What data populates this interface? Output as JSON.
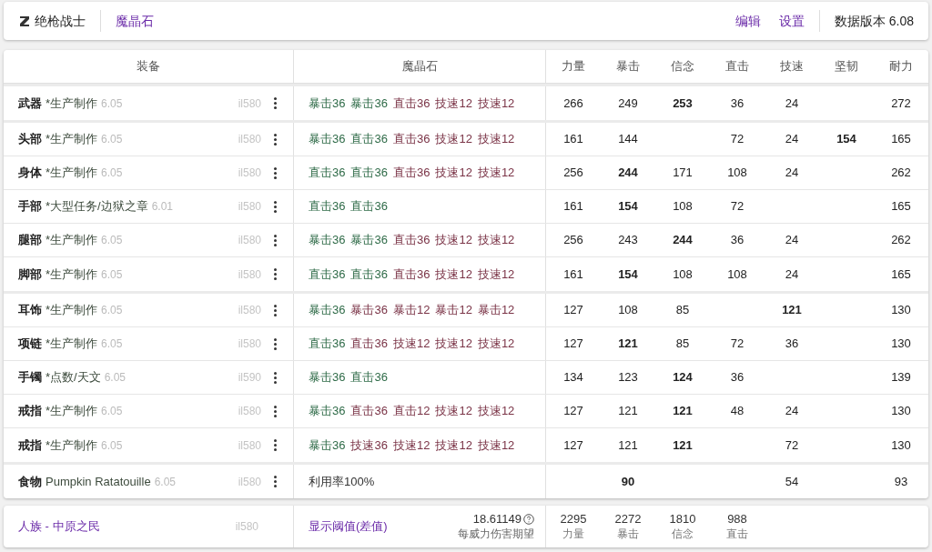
{
  "topbar": {
    "job": "绝枪战士",
    "link": "魔晶石",
    "actions": [
      "编辑",
      "设置"
    ],
    "version": "数据版本 6.08"
  },
  "table": {
    "columns": [
      "装备",
      "魔晶石",
      "力量",
      "暴击",
      "信念",
      "直击",
      "技速",
      "坚韧",
      "耐力"
    ],
    "sections": [
      {
        "rows": [
          {
            "slot": "武器",
            "source": "*生产制作",
            "patch": "6.05",
            "ilvl": "il580",
            "materia": [
              {
                "text": "暴击36",
                "color": "#2f6b48"
              },
              {
                "text": "暴击36",
                "color": "#2f6b48"
              },
              {
                "text": "直击36",
                "color": "#7a3346"
              },
              {
                "text": "技速12",
                "color": "#7a3346"
              },
              {
                "text": "技速12",
                "color": "#7a3346"
              }
            ],
            "stats": {
              "strength": {
                "value": "266",
                "bold": false
              },
              "critical": {
                "value": "249",
                "bold": false
              },
              "determination": {
                "value": "253",
                "bold": true
              },
              "direct_hit": {
                "value": "36",
                "bold": false
              },
              "skill_speed": {
                "value": "24",
                "bold": false
              },
              "vitality": {
                "value": "272",
                "bold": false
              }
            }
          }
        ]
      },
      {
        "rows": [
          {
            "slot": "头部",
            "source": "*生产制作",
            "patch": "6.05",
            "ilvl": "il580",
            "materia": [
              {
                "text": "暴击36",
                "color": "#2f6b48"
              },
              {
                "text": "直击36",
                "color": "#2f6b48"
              },
              {
                "text": "直击36",
                "color": "#7a3346"
              },
              {
                "text": "技速12",
                "color": "#7a3346"
              },
              {
                "text": "技速12",
                "color": "#7a3346"
              }
            ],
            "stats": {
              "strength": {
                "value": "161",
                "bold": false
              },
              "critical": {
                "value": "144",
                "bold": false
              },
              "direct_hit": {
                "value": "72",
                "bold": false
              },
              "skill_speed": {
                "value": "24",
                "bold": false
              },
              "tenacity": {
                "value": "154",
                "bold": true
              },
              "vitality": {
                "value": "165",
                "bold": false
              }
            }
          },
          {
            "slot": "身体",
            "source": "*生产制作",
            "patch": "6.05",
            "ilvl": "il580",
            "materia": [
              {
                "text": "直击36",
                "color": "#2f6b48"
              },
              {
                "text": "直击36",
                "color": "#2f6b48"
              },
              {
                "text": "直击36",
                "color": "#7a3346"
              },
              {
                "text": "技速12",
                "color": "#7a3346"
              },
              {
                "text": "技速12",
                "color": "#7a3346"
              }
            ],
            "stats": {
              "strength": {
                "value": "256",
                "bold": false
              },
              "critical": {
                "value": "244",
                "bold": true
              },
              "determination": {
                "value": "171",
                "bold": false
              },
              "direct_hit": {
                "value": "108",
                "bold": false
              },
              "skill_speed": {
                "value": "24",
                "bold": false
              },
              "vitality": {
                "value": "262",
                "bold": false
              }
            }
          },
          {
            "slot": "手部",
            "source": "*大型任务/边狱之章",
            "patch": "6.01",
            "ilvl": "il580",
            "materia": [
              {
                "text": "直击36",
                "color": "#2f6b48"
              },
              {
                "text": "直击36",
                "color": "#2f6b48"
              }
            ],
            "stats": {
              "strength": {
                "value": "161",
                "bold": false
              },
              "critical": {
                "value": "154",
                "bold": true
              },
              "determination": {
                "value": "108",
                "bold": false
              },
              "direct_hit": {
                "value": "72",
                "bold": false
              },
              "vitality": {
                "value": "165",
                "bold": false
              }
            }
          },
          {
            "slot": "腿部",
            "source": "*生产制作",
            "patch": "6.05",
            "ilvl": "il580",
            "materia": [
              {
                "text": "暴击36",
                "color": "#2f6b48"
              },
              {
                "text": "暴击36",
                "color": "#2f6b48"
              },
              {
                "text": "直击36",
                "color": "#7a3346"
              },
              {
                "text": "技速12",
                "color": "#7a3346"
              },
              {
                "text": "技速12",
                "color": "#7a3346"
              }
            ],
            "stats": {
              "strength": {
                "value": "256",
                "bold": false
              },
              "critical": {
                "value": "243",
                "bold": false
              },
              "determination": {
                "value": "244",
                "bold": true
              },
              "direct_hit": {
                "value": "36",
                "bold": false
              },
              "skill_speed": {
                "value": "24",
                "bold": false
              },
              "vitality": {
                "value": "262",
                "bold": false
              }
            }
          },
          {
            "slot": "脚部",
            "source": "*生产制作",
            "patch": "6.05",
            "ilvl": "il580",
            "materia": [
              {
                "text": "直击36",
                "color": "#2f6b48"
              },
              {
                "text": "直击36",
                "color": "#2f6b48"
              },
              {
                "text": "直击36",
                "color": "#7a3346"
              },
              {
                "text": "技速12",
                "color": "#7a3346"
              },
              {
                "text": "技速12",
                "color": "#7a3346"
              }
            ],
            "stats": {
              "strength": {
                "value": "161",
                "bold": false
              },
              "critical": {
                "value": "154",
                "bold": true
              },
              "determination": {
                "value": "108",
                "bold": false
              },
              "direct_hit": {
                "value": "108",
                "bold": false
              },
              "skill_speed": {
                "value": "24",
                "bold": false
              },
              "vitality": {
                "value": "165",
                "bold": false
              }
            }
          }
        ]
      },
      {
        "rows": [
          {
            "slot": "耳饰",
            "source": "*生产制作",
            "patch": "6.05",
            "ilvl": "il580",
            "materia": [
              {
                "text": "暴击36",
                "color": "#2f6b48"
              },
              {
                "text": "暴击36",
                "color": "#7a3346"
              },
              {
                "text": "暴击12",
                "color": "#7a3346"
              },
              {
                "text": "暴击12",
                "color": "#7a3346"
              },
              {
                "text": "暴击12",
                "color": "#7a3346"
              }
            ],
            "stats": {
              "strength": {
                "value": "127",
                "bold": false
              },
              "critical": {
                "value": "108",
                "bold": false
              },
              "determination": {
                "value": "85",
                "bold": false
              },
              "skill_speed": {
                "value": "121",
                "bold": true
              },
              "vitality": {
                "value": "130",
                "bold": false
              }
            }
          },
          {
            "slot": "项链",
            "source": "*生产制作",
            "patch": "6.05",
            "ilvl": "il580",
            "materia": [
              {
                "text": "直击36",
                "color": "#2f6b48"
              },
              {
                "text": "直击36",
                "color": "#7a3346"
              },
              {
                "text": "技速12",
                "color": "#7a3346"
              },
              {
                "text": "技速12",
                "color": "#7a3346"
              },
              {
                "text": "技速12",
                "color": "#7a3346"
              }
            ],
            "stats": {
              "strength": {
                "value": "127",
                "bold": false
              },
              "critical": {
                "value": "121",
                "bold": true
              },
              "determination": {
                "value": "85",
                "bold": false
              },
              "direct_hit": {
                "value": "72",
                "bold": false
              },
              "skill_speed": {
                "value": "36",
                "bold": false
              },
              "vitality": {
                "value": "130",
                "bold": false
              }
            }
          },
          {
            "slot": "手镯",
            "source": "*点数/天文",
            "patch": "6.05",
            "ilvl": "il590",
            "materia": [
              {
                "text": "暴击36",
                "color": "#2f6b48"
              },
              {
                "text": "直击36",
                "color": "#2f6b48"
              }
            ],
            "stats": {
              "strength": {
                "value": "134",
                "bold": false
              },
              "critical": {
                "value": "123",
                "bold": false
              },
              "determination": {
                "value": "124",
                "bold": true
              },
              "direct_hit": {
                "value": "36",
                "bold": false
              },
              "vitality": {
                "value": "139",
                "bold": false
              }
            }
          },
          {
            "slot": "戒指",
            "source": "*生产制作",
            "patch": "6.05",
            "ilvl": "il580",
            "materia": [
              {
                "text": "暴击36",
                "color": "#2f6b48"
              },
              {
                "text": "直击36",
                "color": "#7a3346"
              },
              {
                "text": "直击12",
                "color": "#7a3346"
              },
              {
                "text": "技速12",
                "color": "#7a3346"
              },
              {
                "text": "技速12",
                "color": "#7a3346"
              }
            ],
            "stats": {
              "strength": {
                "value": "127",
                "bold": false
              },
              "critical": {
                "value": "121",
                "bold": false
              },
              "determination": {
                "value": "121",
                "bold": true
              },
              "direct_hit": {
                "value": "48",
                "bold": false
              },
              "skill_speed": {
                "value": "24",
                "bold": false
              },
              "vitality": {
                "value": "130",
                "bold": false
              }
            }
          },
          {
            "slot": "戒指",
            "source": "*生产制作",
            "patch": "6.05",
            "ilvl": "il580",
            "materia": [
              {
                "text": "暴击36",
                "color": "#2f6b48"
              },
              {
                "text": "技速36",
                "color": "#7a3346"
              },
              {
                "text": "技速12",
                "color": "#7a3346"
              },
              {
                "text": "技速12",
                "color": "#7a3346"
              },
              {
                "text": "技速12",
                "color": "#7a3346"
              }
            ],
            "stats": {
              "strength": {
                "value": "127",
                "bold": false
              },
              "critical": {
                "value": "121",
                "bold": false
              },
              "determination": {
                "value": "121",
                "bold": true
              },
              "skill_speed": {
                "value": "72",
                "bold": false
              },
              "vitality": {
                "value": "130",
                "bold": false
              }
            }
          }
        ]
      },
      {
        "rows": [
          {
            "slot": "食物",
            "source": "Pumpkin Ratatouille",
            "patch": "6.05",
            "ilvl": "il580",
            "note": "利用率100%",
            "stats": {
              "critical": {
                "value": "90",
                "bold": true
              },
              "skill_speed": {
                "value": "54",
                "bold": false
              },
              "vitality": {
                "value": "93",
                "bold": false
              }
            }
          }
        ]
      }
    ]
  },
  "footer": {
    "race": "人族 - 中原之民",
    "ilvl": "il580",
    "threshold": "显示阈值(差值)",
    "damage": "18.61149",
    "damage_label": "每威力伤害期望",
    "totals": [
      {
        "value": "2295",
        "label": "力量"
      },
      {
        "value": "2272",
        "label": "暴击"
      },
      {
        "value": "1810",
        "label": "信念"
      },
      {
        "value": "988",
        "label": "直击"
      }
    ]
  }
}
